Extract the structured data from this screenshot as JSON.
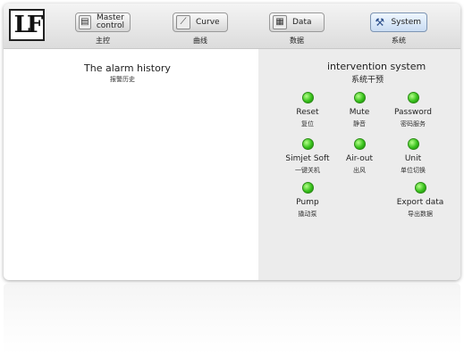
{
  "logo": {
    "text": "LF"
  },
  "nav": [
    {
      "label": "Master control",
      "cn": "主控",
      "icon": "monitor-icon"
    },
    {
      "label": "Curve",
      "cn": "曲线",
      "icon": "chart-icon"
    },
    {
      "label": "Data",
      "cn": "数据",
      "icon": "table-icon"
    },
    {
      "label": "System",
      "cn": "系统",
      "icon": "tools-icon"
    }
  ],
  "alarm": {
    "title": "The alarm history",
    "cn": "报警历史"
  },
  "intervention": {
    "title": "intervention system",
    "cn": "系统干预"
  },
  "indicators": [
    {
      "label": "Reset",
      "cn": "复位",
      "color": "#3cc81e"
    },
    {
      "label": "Mute",
      "cn": "静音",
      "color": "#3cc81e"
    },
    {
      "label": "Password",
      "cn": "密码服务",
      "color": "#3cc81e"
    },
    {
      "label": "Simjet Soft",
      "cn": "一键关机",
      "color": "#3cc81e"
    },
    {
      "label": "Air-out",
      "cn": "出风",
      "color": "#3cc81e"
    },
    {
      "label": "Unit",
      "cn": "单位切换",
      "color": "#3cc81e"
    },
    {
      "label": "Pump",
      "cn": "撬动泵",
      "color": "#3cc81e"
    },
    {
      "label": "Export data",
      "cn": "导出数据",
      "color": "#3cc81e"
    }
  ],
  "colors": {
    "active_tab": "#c9dcf2",
    "panel": "#ececec",
    "led": "#3cc81e"
  }
}
